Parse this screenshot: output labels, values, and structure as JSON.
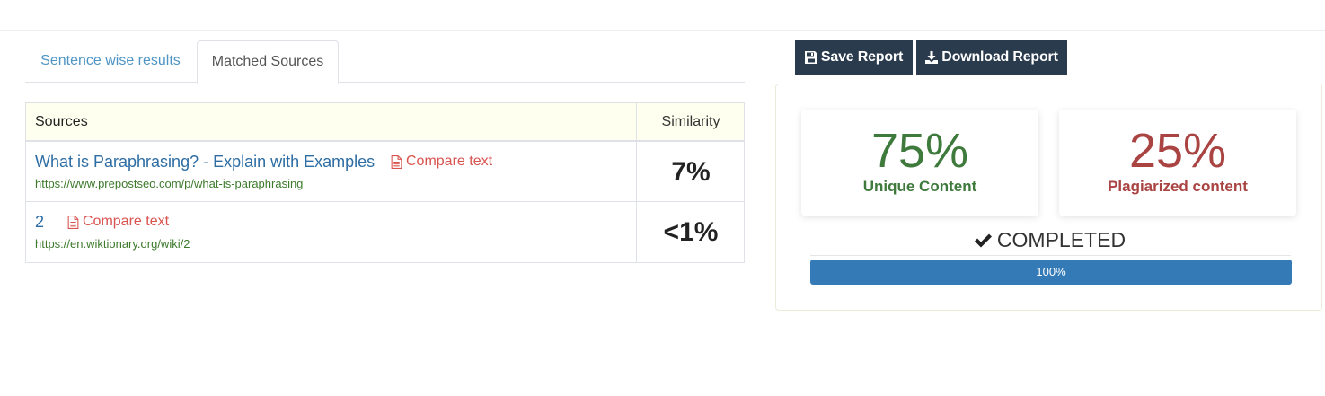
{
  "tabs": [
    {
      "label": "Sentence wise results"
    },
    {
      "label": "Matched Sources"
    }
  ],
  "table": {
    "headers": {
      "sources": "Sources",
      "similarity": "Similarity"
    },
    "rows": [
      {
        "title": "What is Paraphrasing? - Explain with Examples",
        "compare_label": "Compare text",
        "url": "https://www.prepostseo.com/p/what-is-paraphrasing",
        "similarity": "7%"
      },
      {
        "title": "2",
        "compare_label": "Compare text",
        "url": "https://en.wiktionary.org/wiki/2",
        "similarity": "<1%"
      }
    ]
  },
  "buttons": {
    "save": "Save Report",
    "download": "Download Report"
  },
  "results": {
    "unique": {
      "value": "75%",
      "label": "Unique Content"
    },
    "plagiarized": {
      "value": "25%",
      "label": "Plagiarized content"
    },
    "status": "COMPLETED",
    "progress": {
      "percent": 100,
      "label": "100%"
    }
  },
  "colors": {
    "unique": "#3f7a3d",
    "plagiarized": "#a94442",
    "button_bg": "#2b3b4e",
    "progress": "#337ab7",
    "link": "#2d6da3",
    "compare": "#d9534f"
  },
  "icons": {
    "compare": "file-text-icon",
    "save": "floppy-disk-icon",
    "download": "download-icon",
    "status": "check-icon"
  }
}
